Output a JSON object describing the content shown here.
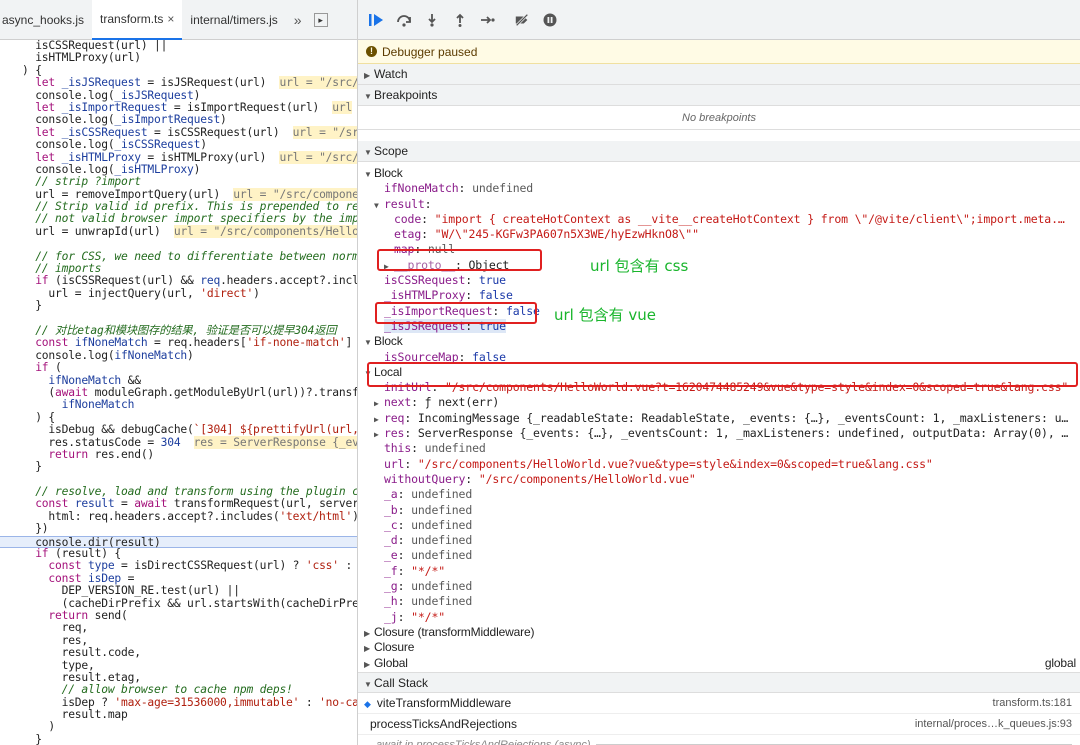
{
  "tabs": [
    {
      "label": "async_hooks.js",
      "active": false
    },
    {
      "label": "transform.ts",
      "active": true,
      "close": "×"
    },
    {
      "label": "internal/timers.js",
      "active": false
    }
  ],
  "tabs_more": "»",
  "code_lines": [
    [
      {
        "t": "  isCSSRequest(url) ||",
        "c": "fn"
      }
    ],
    [
      {
        "t": "  isHTMLProxy(url)",
        "c": "fn"
      }
    ],
    [
      {
        "t": ") {",
        "c": "fn"
      }
    ],
    [
      {
        "t": "  let ",
        "c": "kw"
      },
      {
        "t": "_isJSRequest",
        "c": "id"
      },
      {
        "t": " = isJSRequest(url)  ",
        "c": "fn"
      },
      {
        "t": "url = \"/src/",
        "c": "inl"
      }
    ],
    [
      {
        "t": "  console.log(",
        "c": "fn"
      },
      {
        "t": "_isJSRequest",
        "c": "id"
      },
      {
        "t": ")",
        "c": "fn"
      }
    ],
    [
      {
        "t": "  let ",
        "c": "kw"
      },
      {
        "t": "_isImportRequest",
        "c": "id"
      },
      {
        "t": " = isImportRequest(url)  ",
        "c": "fn"
      },
      {
        "t": "url",
        "c": "inl"
      }
    ],
    [
      {
        "t": "  console.log(",
        "c": "fn"
      },
      {
        "t": "_isImportRequest",
        "c": "id"
      },
      {
        "t": ")",
        "c": "fn"
      }
    ],
    [
      {
        "t": "  let ",
        "c": "kw"
      },
      {
        "t": "_isCSSRequest",
        "c": "id"
      },
      {
        "t": " = isCSSRequest(url)  ",
        "c": "fn"
      },
      {
        "t": "url = \"/src/",
        "c": "inl"
      }
    ],
    [
      {
        "t": "  console.log(",
        "c": "fn"
      },
      {
        "t": "_isCSSRequest",
        "c": "id"
      },
      {
        "t": ")",
        "c": "fn"
      }
    ],
    [
      {
        "t": "  let ",
        "c": "kw"
      },
      {
        "t": "_isHTMLProxy",
        "c": "id"
      },
      {
        "t": " = isHTMLProxy(url)  ",
        "c": "fn"
      },
      {
        "t": "url = \"/src/",
        "c": "inl"
      }
    ],
    [
      {
        "t": "  console.log(",
        "c": "fn"
      },
      {
        "t": "_isHTMLProxy",
        "c": "id"
      },
      {
        "t": ")",
        "c": "fn"
      }
    ],
    [
      {
        "t": "  // strip ?import",
        "c": "cm"
      }
    ],
    [
      {
        "t": "  url = removeImportQuery(url)  ",
        "c": "fn"
      },
      {
        "t": "url = \"/src/compone",
        "c": "inl"
      }
    ],
    [
      {
        "t": "  // Strip valid id prefix. This is prepended to re",
        "c": "cm"
      }
    ],
    [
      {
        "t": "  // not valid browser import specifiers by the imp",
        "c": "cm"
      }
    ],
    [
      {
        "t": "  url = unwrapId(url)  ",
        "c": "fn"
      },
      {
        "t": "url = \"/src/components/Hello",
        "c": "inl"
      }
    ],
    [
      {
        "t": "",
        "c": "fn"
      }
    ],
    [
      {
        "t": "  // for CSS, we need to differentiate between norm",
        "c": "cm"
      }
    ],
    [
      {
        "t": "  // imports",
        "c": "cm"
      }
    ],
    [
      {
        "t": "  if ",
        "c": "kw"
      },
      {
        "t": "(isCSSRequest(url) && ",
        "c": "fn"
      },
      {
        "t": "req",
        "c": "id"
      },
      {
        "t": ".headers.accept?.incl",
        "c": "fn"
      }
    ],
    [
      {
        "t": "    url = injectQuery(url, ",
        "c": "fn"
      },
      {
        "t": "'direct'",
        "c": "str"
      },
      {
        "t": ")",
        "c": "fn"
      }
    ],
    [
      {
        "t": "  }",
        "c": "fn"
      }
    ],
    [
      {
        "t": "",
        "c": "fn"
      }
    ],
    [
      {
        "t": "  // 对比etag和模块图存的结果, 验证是否可以提早304返回",
        "c": "cm"
      }
    ],
    [
      {
        "t": "  const ",
        "c": "kw"
      },
      {
        "t": "ifNoneMatch",
        "c": "id"
      },
      {
        "t": " = req.headers[",
        "c": "fn"
      },
      {
        "t": "'if-none-match'",
        "c": "str"
      },
      {
        "t": "]",
        "c": "fn"
      }
    ],
    [
      {
        "t": "  console.log(",
        "c": "fn"
      },
      {
        "t": "ifNoneMatch",
        "c": "id"
      },
      {
        "t": ")",
        "c": "fn"
      }
    ],
    [
      {
        "t": "  if ",
        "c": "kw"
      },
      {
        "t": "(",
        "c": "fn"
      }
    ],
    [
      {
        "t": "    ifNoneMatch",
        "c": "id"
      },
      {
        "t": " &&",
        "c": "fn"
      }
    ],
    [
      {
        "t": "    (",
        "c": "fn"
      },
      {
        "t": "await ",
        "c": "kw"
      },
      {
        "t": "moduleGraph.getModuleByUrl(url))?.transf",
        "c": "fn"
      }
    ],
    [
      {
        "t": "      ifNoneMatch",
        "c": "id"
      }
    ],
    [
      {
        "t": "  ) {",
        "c": "fn"
      }
    ],
    [
      {
        "t": "    isDebug && debugCache(",
        "c": "fn"
      },
      {
        "t": "`[304] ${prettifyUrl(url,",
        "c": "str"
      }
    ],
    [
      {
        "t": "    res.statusCode = ",
        "c": "fn"
      },
      {
        "t": "304",
        "c": "id"
      },
      {
        "t": "  ",
        "c": "fn"
      },
      {
        "t": "res = ServerResponse {_ev",
        "c": "inl"
      }
    ],
    [
      {
        "t": "    return ",
        "c": "kw"
      },
      {
        "t": "res.end()",
        "c": "fn"
      }
    ],
    [
      {
        "t": "  }",
        "c": "fn"
      }
    ],
    [
      {
        "t": "",
        "c": "fn"
      }
    ],
    [
      {
        "t": "  // resolve, load and transform using the plugin c",
        "c": "cm"
      }
    ],
    [
      {
        "t": "  const ",
        "c": "kw"
      },
      {
        "t": "result",
        "c": "id"
      },
      {
        "t": " = ",
        "c": "fn"
      },
      {
        "t": "await ",
        "c": "kw"
      },
      {
        "t": "transformRequest(url, server",
        "c": "fn"
      }
    ],
    [
      {
        "t": "    html: req.headers.accept?.includes(",
        "c": "fn"
      },
      {
        "t": "'text/html'",
        "c": "str"
      },
      {
        "t": ")",
        "c": "fn"
      }
    ],
    [
      {
        "t": "  })",
        "c": "fn"
      }
    ],
    [
      {
        "t": "  console.dir(result)",
        "c": "fn",
        "hl": true
      }
    ],
    [
      {
        "t": "  if ",
        "c": "kw"
      },
      {
        "t": "(result) {",
        "c": "fn"
      }
    ],
    [
      {
        "t": "    const ",
        "c": "kw"
      },
      {
        "t": "type",
        "c": "id"
      },
      {
        "t": " = isDirectCSSRequest(url) ? ",
        "c": "fn"
      },
      {
        "t": "'css'",
        "c": "str"
      },
      {
        "t": " :",
        "c": "fn"
      }
    ],
    [
      {
        "t": "    const ",
        "c": "kw"
      },
      {
        "t": "isDep",
        "c": "id"
      },
      {
        "t": " =",
        "c": "fn"
      }
    ],
    [
      {
        "t": "      DEP_VERSION_RE.test(url) ||",
        "c": "fn"
      }
    ],
    [
      {
        "t": "      (cacheDirPrefix && url.startsWith(cacheDirPre",
        "c": "fn"
      }
    ],
    [
      {
        "t": "    return ",
        "c": "kw"
      },
      {
        "t": "send(",
        "c": "fn"
      }
    ],
    [
      {
        "t": "      req,",
        "c": "fn"
      }
    ],
    [
      {
        "t": "      res,",
        "c": "fn"
      }
    ],
    [
      {
        "t": "      result.code,",
        "c": "fn"
      }
    ],
    [
      {
        "t": "      type,",
        "c": "fn"
      }
    ],
    [
      {
        "t": "      result.etag,",
        "c": "fn"
      }
    ],
    [
      {
        "t": "      // allow browser to cache npm deps!",
        "c": "cm"
      }
    ],
    [
      {
        "t": "      isDep ? ",
        "c": "fn"
      },
      {
        "t": "'max-age=31536000,immutable'",
        "c": "str"
      },
      {
        "t": " : ",
        "c": "fn"
      },
      {
        "t": "'no-ca",
        "c": "str"
      }
    ],
    [
      {
        "t": "      result.map",
        "c": "fn"
      }
    ],
    [
      {
        "t": "    )",
        "c": "fn"
      }
    ],
    [
      {
        "t": "  }",
        "c": "fn"
      }
    ],
    [
      {
        "t": "}",
        "c": "fn"
      }
    ]
  ],
  "debugger_status": "Debugger paused",
  "sections": {
    "watch": "Watch",
    "breakpoints": "Breakpoints",
    "no_breakpoints": "No breakpoints",
    "scope": "Scope",
    "call_stack": "Call Stack"
  },
  "scope_lines": [
    {
      "indent": 0,
      "arrow": "▼",
      "grp": "Block"
    },
    {
      "indent": 1,
      "k": "ifNoneMatch",
      "v": "undefined",
      "vc": "vn"
    },
    {
      "indent": 1,
      "arrow": "▼",
      "k": "result",
      "v": "",
      "vc": "vo"
    },
    {
      "indent": 2,
      "k": "code",
      "v": "\"import { createHotContext as __vite__createHotContext } from \\\"/@vite/client\\\";import.meta.…",
      "vc": "vs"
    },
    {
      "indent": 2,
      "k": "etag",
      "v": "\"W/\\\"245-KGFw3PA607n5X3WE/hyEzwHknO8\\\"\"",
      "vc": "vs"
    },
    {
      "indent": 2,
      "k": "map",
      "v": "null",
      "vc": "vn"
    },
    {
      "indent": 2,
      "arrow": "▶",
      "k": "__proto__",
      "v": "Object",
      "vc": "vo",
      "dim": true
    },
    {
      "indent": 1,
      "k": "isCSSRequest",
      "v": "true",
      "vc": "vb"
    },
    {
      "indent": 1,
      "k": "_isHTMLProxy",
      "v": "false",
      "vc": "vb"
    },
    {
      "indent": 1,
      "k": "_isImportRequest",
      "v": "false",
      "vc": "vb"
    },
    {
      "indent": 1,
      "k": "_isJSRequest",
      "v": "true",
      "vc": "vb",
      "sel": true
    },
    {
      "indent": 0,
      "arrow": "▼",
      "grp": "Block"
    },
    {
      "indent": 1,
      "k": "isSourceMap",
      "v": "false",
      "vc": "vb"
    },
    {
      "indent": 0,
      "arrow": "▼",
      "grp": "Local"
    },
    {
      "indent": 1,
      "k": "initUrl",
      "v": "\"/src/components/HelloWorld.vue?t=1620474485249&vue&type=style&index=0&scoped=true&lang.css\"",
      "vc": "vs"
    },
    {
      "indent": 1,
      "arrow": "▶",
      "k": "next",
      "v": "ƒ next(err)",
      "vc": "vo"
    },
    {
      "indent": 1,
      "arrow": "▶",
      "k": "req",
      "v": "IncomingMessage {_readableState: ReadableState, _events: {…}, _eventsCount: 1, _maxListeners: u…",
      "vc": "vo"
    },
    {
      "indent": 1,
      "arrow": "▶",
      "k": "res",
      "v": "ServerResponse {_events: {…}, _eventsCount: 1, _maxListeners: undefined, outputData: Array(0), …",
      "vc": "vo"
    },
    {
      "indent": 1,
      "k": "this",
      "v": "undefined",
      "vc": "vn"
    },
    {
      "indent": 1,
      "k": "url",
      "v": "\"/src/components/HelloWorld.vue?vue&type=style&index=0&scoped=true&lang.css\"",
      "vc": "vs"
    },
    {
      "indent": 1,
      "k": "withoutQuery",
      "v": "\"/src/components/HelloWorld.vue\"",
      "vc": "vs"
    },
    {
      "indent": 1,
      "k": "_a",
      "v": "undefined",
      "vc": "vn"
    },
    {
      "indent": 1,
      "k": "_b",
      "v": "undefined",
      "vc": "vn"
    },
    {
      "indent": 1,
      "k": "_c",
      "v": "undefined",
      "vc": "vn"
    },
    {
      "indent": 1,
      "k": "_d",
      "v": "undefined",
      "vc": "vn"
    },
    {
      "indent": 1,
      "k": "_e",
      "v": "undefined",
      "vc": "vn"
    },
    {
      "indent": 1,
      "k": "_f",
      "v": "\"*/*\"",
      "vc": "vs"
    },
    {
      "indent": 1,
      "k": "_g",
      "v": "undefined",
      "vc": "vn"
    },
    {
      "indent": 1,
      "k": "_h",
      "v": "undefined",
      "vc": "vn"
    },
    {
      "indent": 1,
      "k": "_j",
      "v": "\"*/*\"",
      "vc": "vs"
    },
    {
      "indent": 0,
      "arrow": "▶",
      "grp": "Closure (transformMiddleware)"
    },
    {
      "indent": 0,
      "arrow": "▶",
      "grp": "Closure"
    },
    {
      "indent": 0,
      "arrow": "▶",
      "grp": "Global",
      "right": "global"
    }
  ],
  "annotations": {
    "css_note": "url 包含有 css",
    "vue_note": "url 包含有 vue"
  },
  "call_stack": [
    {
      "fn": "viteTransformMiddleware",
      "loc": "transform.ts:181",
      "current": true
    },
    {
      "fn": "processTicksAndRejections",
      "loc": "internal/proces…k_queues.js:93",
      "current": false
    }
  ],
  "async_label": "await in processTicksAndRejections (async)"
}
